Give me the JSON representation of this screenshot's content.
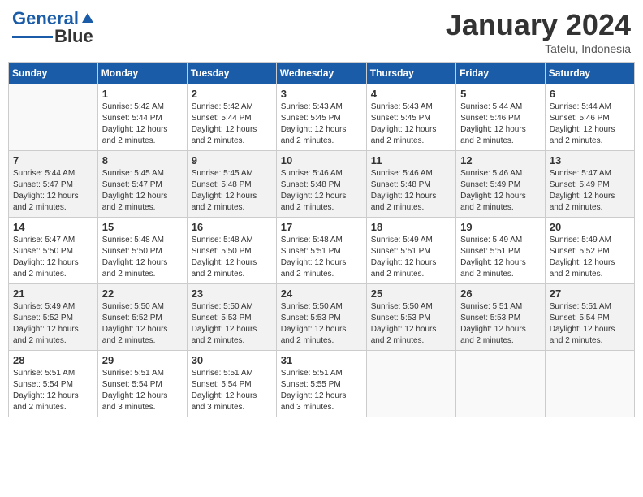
{
  "header": {
    "logo_line1": "General",
    "logo_line2": "Blue",
    "month": "January 2024",
    "location": "Tatelu, Indonesia"
  },
  "days_of_week": [
    "Sunday",
    "Monday",
    "Tuesday",
    "Wednesday",
    "Thursday",
    "Friday",
    "Saturday"
  ],
  "weeks": [
    [
      {
        "day": "",
        "empty": true
      },
      {
        "day": "1",
        "sunrise": "Sunrise: 5:42 AM",
        "sunset": "Sunset: 5:44 PM",
        "daylight": "Daylight: 12 hours and 2 minutes."
      },
      {
        "day": "2",
        "sunrise": "Sunrise: 5:42 AM",
        "sunset": "Sunset: 5:44 PM",
        "daylight": "Daylight: 12 hours and 2 minutes."
      },
      {
        "day": "3",
        "sunrise": "Sunrise: 5:43 AM",
        "sunset": "Sunset: 5:45 PM",
        "daylight": "Daylight: 12 hours and 2 minutes."
      },
      {
        "day": "4",
        "sunrise": "Sunrise: 5:43 AM",
        "sunset": "Sunset: 5:45 PM",
        "daylight": "Daylight: 12 hours and 2 minutes."
      },
      {
        "day": "5",
        "sunrise": "Sunrise: 5:44 AM",
        "sunset": "Sunset: 5:46 PM",
        "daylight": "Daylight: 12 hours and 2 minutes."
      },
      {
        "day": "6",
        "sunrise": "Sunrise: 5:44 AM",
        "sunset": "Sunset: 5:46 PM",
        "daylight": "Daylight: 12 hours and 2 minutes."
      }
    ],
    [
      {
        "day": "7",
        "sunrise": "Sunrise: 5:44 AM",
        "sunset": "Sunset: 5:47 PM",
        "daylight": "Daylight: 12 hours and 2 minutes."
      },
      {
        "day": "8",
        "sunrise": "Sunrise: 5:45 AM",
        "sunset": "Sunset: 5:47 PM",
        "daylight": "Daylight: 12 hours and 2 minutes."
      },
      {
        "day": "9",
        "sunrise": "Sunrise: 5:45 AM",
        "sunset": "Sunset: 5:48 PM",
        "daylight": "Daylight: 12 hours and 2 minutes."
      },
      {
        "day": "10",
        "sunrise": "Sunrise: 5:46 AM",
        "sunset": "Sunset: 5:48 PM",
        "daylight": "Daylight: 12 hours and 2 minutes."
      },
      {
        "day": "11",
        "sunrise": "Sunrise: 5:46 AM",
        "sunset": "Sunset: 5:48 PM",
        "daylight": "Daylight: 12 hours and 2 minutes."
      },
      {
        "day": "12",
        "sunrise": "Sunrise: 5:46 AM",
        "sunset": "Sunset: 5:49 PM",
        "daylight": "Daylight: 12 hours and 2 minutes."
      },
      {
        "day": "13",
        "sunrise": "Sunrise: 5:47 AM",
        "sunset": "Sunset: 5:49 PM",
        "daylight": "Daylight: 12 hours and 2 minutes."
      }
    ],
    [
      {
        "day": "14",
        "sunrise": "Sunrise: 5:47 AM",
        "sunset": "Sunset: 5:50 PM",
        "daylight": "Daylight: 12 hours and 2 minutes."
      },
      {
        "day": "15",
        "sunrise": "Sunrise: 5:48 AM",
        "sunset": "Sunset: 5:50 PM",
        "daylight": "Daylight: 12 hours and 2 minutes."
      },
      {
        "day": "16",
        "sunrise": "Sunrise: 5:48 AM",
        "sunset": "Sunset: 5:50 PM",
        "daylight": "Daylight: 12 hours and 2 minutes."
      },
      {
        "day": "17",
        "sunrise": "Sunrise: 5:48 AM",
        "sunset": "Sunset: 5:51 PM",
        "daylight": "Daylight: 12 hours and 2 minutes."
      },
      {
        "day": "18",
        "sunrise": "Sunrise: 5:49 AM",
        "sunset": "Sunset: 5:51 PM",
        "daylight": "Daylight: 12 hours and 2 minutes."
      },
      {
        "day": "19",
        "sunrise": "Sunrise: 5:49 AM",
        "sunset": "Sunset: 5:51 PM",
        "daylight": "Daylight: 12 hours and 2 minutes."
      },
      {
        "day": "20",
        "sunrise": "Sunrise: 5:49 AM",
        "sunset": "Sunset: 5:52 PM",
        "daylight": "Daylight: 12 hours and 2 minutes."
      }
    ],
    [
      {
        "day": "21",
        "sunrise": "Sunrise: 5:49 AM",
        "sunset": "Sunset: 5:52 PM",
        "daylight": "Daylight: 12 hours and 2 minutes."
      },
      {
        "day": "22",
        "sunrise": "Sunrise: 5:50 AM",
        "sunset": "Sunset: 5:52 PM",
        "daylight": "Daylight: 12 hours and 2 minutes."
      },
      {
        "day": "23",
        "sunrise": "Sunrise: 5:50 AM",
        "sunset": "Sunset: 5:53 PM",
        "daylight": "Daylight: 12 hours and 2 minutes."
      },
      {
        "day": "24",
        "sunrise": "Sunrise: 5:50 AM",
        "sunset": "Sunset: 5:53 PM",
        "daylight": "Daylight: 12 hours and 2 minutes."
      },
      {
        "day": "25",
        "sunrise": "Sunrise: 5:50 AM",
        "sunset": "Sunset: 5:53 PM",
        "daylight": "Daylight: 12 hours and 2 minutes."
      },
      {
        "day": "26",
        "sunrise": "Sunrise: 5:51 AM",
        "sunset": "Sunset: 5:53 PM",
        "daylight": "Daylight: 12 hours and 2 minutes."
      },
      {
        "day": "27",
        "sunrise": "Sunrise: 5:51 AM",
        "sunset": "Sunset: 5:54 PM",
        "daylight": "Daylight: 12 hours and 2 minutes."
      }
    ],
    [
      {
        "day": "28",
        "sunrise": "Sunrise: 5:51 AM",
        "sunset": "Sunset: 5:54 PM",
        "daylight": "Daylight: 12 hours and 2 minutes."
      },
      {
        "day": "29",
        "sunrise": "Sunrise: 5:51 AM",
        "sunset": "Sunset: 5:54 PM",
        "daylight": "Daylight: 12 hours and 3 minutes."
      },
      {
        "day": "30",
        "sunrise": "Sunrise: 5:51 AM",
        "sunset": "Sunset: 5:54 PM",
        "daylight": "Daylight: 12 hours and 3 minutes."
      },
      {
        "day": "31",
        "sunrise": "Sunrise: 5:51 AM",
        "sunset": "Sunset: 5:55 PM",
        "daylight": "Daylight: 12 hours and 3 minutes."
      },
      {
        "day": "",
        "empty": true
      },
      {
        "day": "",
        "empty": true
      },
      {
        "day": "",
        "empty": true
      }
    ]
  ]
}
